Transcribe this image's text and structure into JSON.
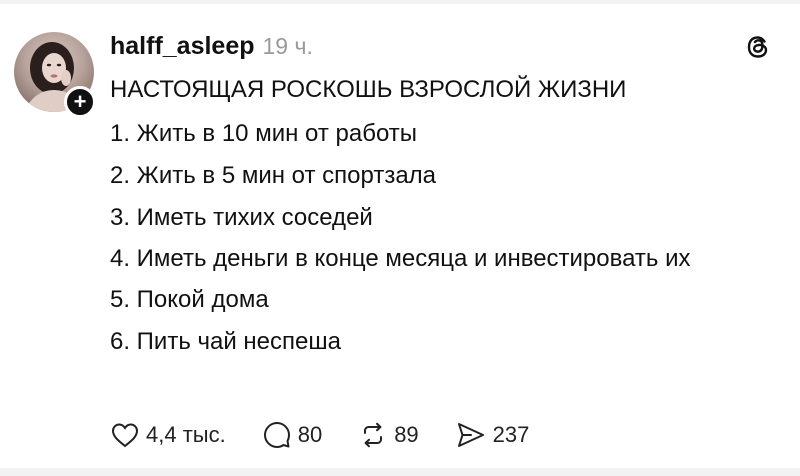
{
  "post": {
    "username": "halff_asleep",
    "time": "19 ч.",
    "title": "НАСТОЯЩАЯ РОСКОШЬ ВЗРОСЛОЙ ЖИЗНИ",
    "items": [
      "1. Жить в 10 мин от работы",
      "2. Жить в 5 мин от спортзала",
      "3. Иметь тихих соседей",
      "4. Иметь деньги в конце месяца и инвестировать их",
      "5. Покой дома",
      "6. Пить чай неспеша"
    ]
  },
  "actions": {
    "likes": "4,4 тыс.",
    "comments": "80",
    "reposts": "89",
    "shares": "237"
  },
  "icons": {
    "avatar": "avatar",
    "follow": "plus-icon",
    "brand": "threads-logo-icon",
    "like": "heart-icon",
    "comment": "comment-bubble-icon",
    "repost": "repost-icon",
    "share": "send-icon"
  }
}
